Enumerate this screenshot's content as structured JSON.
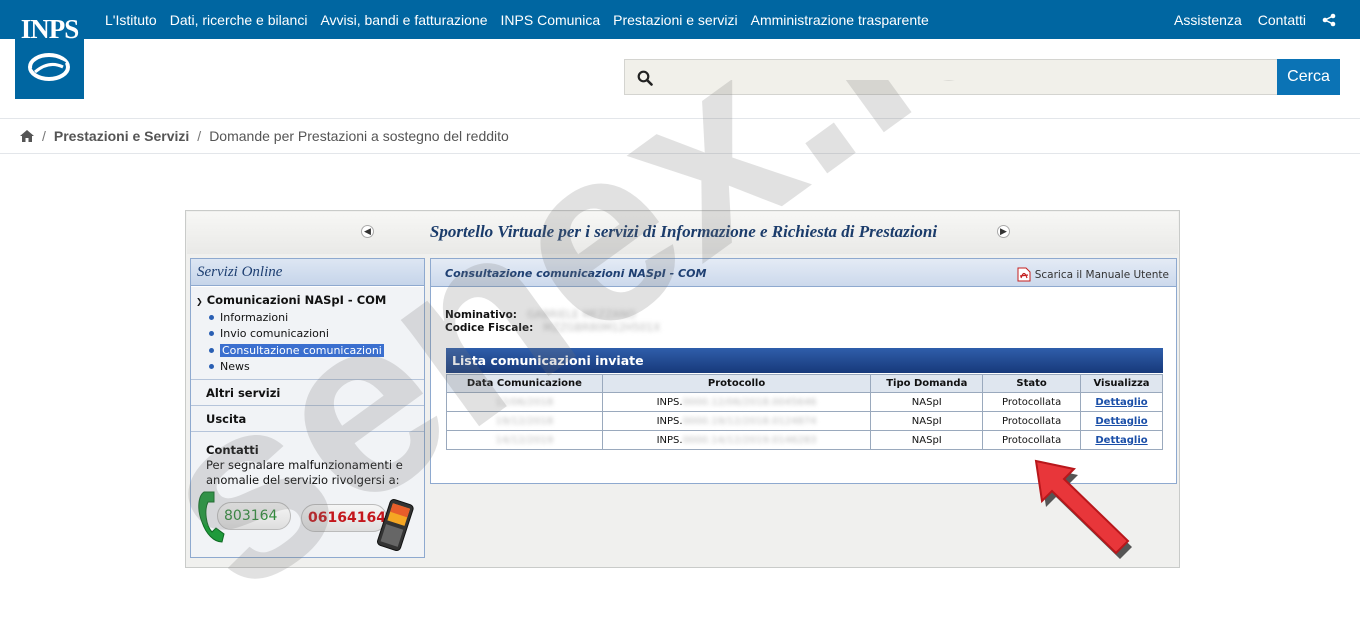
{
  "topnav": {
    "items": [
      "L'Istituto",
      "Dati, ricerche e bilanci",
      "Avvisi, bandi e fatturazione",
      "INPS Comunica",
      "Prestazioni e servizi",
      "Amministrazione trasparente"
    ],
    "right": [
      "Assistenza",
      "Contatti"
    ]
  },
  "logo": {
    "text": "INPS"
  },
  "search": {
    "placeholder": "",
    "button": "Cerca"
  },
  "breadcrumb": {
    "level1": "Prestazioni e Servizi",
    "level2": "Domande per Prestazioni a sostegno del reddito",
    "separator": "/"
  },
  "portal": {
    "title": "Sportello Virtuale per i servizi di Informazione e Richiesta di Prestazioni"
  },
  "sidebar": {
    "header": "Servizi Online",
    "group": "Comunicazioni NASpI - COM",
    "items": [
      "Informazioni",
      "Invio comunicazioni",
      "Consultazione comunicazioni",
      "News"
    ],
    "selected_index": 2,
    "other": "Altri servizi",
    "exit": "Uscita",
    "contacts_title": "Contatti",
    "contacts_text": "Per segnalare malfunzionamenti e anomalie del servizio rivolgersi a:",
    "phone1": "803164",
    "phone2": "06164164"
  },
  "main": {
    "title": "Consultazione comunicazioni NASpI - COM",
    "manual_link": "Scarica il Manuale Utente",
    "nominativo_label": "Nominativo:",
    "nominativo_value": "GABRIELE MEZZANO",
    "cf_label": "Codice Fiscale:",
    "cf_value": "MZZGBR80M12H501X",
    "list_title": "Lista comunicazioni inviate",
    "columns": [
      "Data Comunicazione",
      "Protocollo",
      "Tipo Domanda",
      "Stato",
      "Visualizza"
    ],
    "rows": [
      {
        "date": "12/06/2018",
        "protocol_prefix": "INPS.",
        "protocol_rest": "0000.12/06/2018.0045646",
        "type": "NASpI",
        "status": "Protocollata",
        "link": "Dettaglio"
      },
      {
        "date": "19/12/2018",
        "protocol_prefix": "INPS.",
        "protocol_rest": "0000.19/12/2018.0124874",
        "type": "NASpI",
        "status": "Protocollata",
        "link": "Dettaglio"
      },
      {
        "date": "14/12/2019",
        "protocol_prefix": "INPS.",
        "protocol_rest": "0000.14/12/2019.0146283",
        "type": "NASpI",
        "status": "Protocollata",
        "link": "Dettaglio"
      }
    ]
  },
  "watermark": {
    "text": "senex.it"
  },
  "colors": {
    "topbar": "#0066a1",
    "search_button": "#0b73b5",
    "portal_title": "#1b3c6b",
    "list_header": "#17397a",
    "arrow": "#e8363a"
  }
}
